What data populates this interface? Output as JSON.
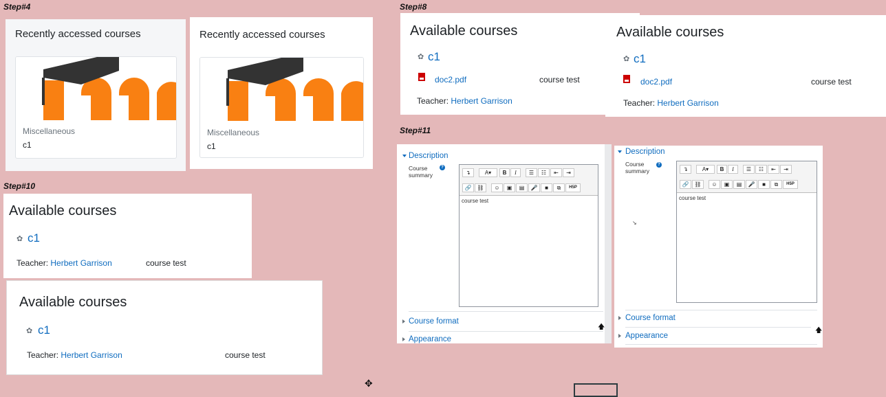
{
  "steps": {
    "step4": "Step#4",
    "step8": "Step#8",
    "step10": "Step#10",
    "step11": "Step#11"
  },
  "recently_accessed": {
    "title": "Recently accessed courses",
    "category": "Miscellaneous",
    "course_name": "c1"
  },
  "available": {
    "title": "Available courses",
    "course_link": "c1",
    "file_name": "doc2.pdf",
    "summary": "course test",
    "teacher_label": "Teacher:",
    "teacher_name": "Herbert Garrison"
  },
  "edit_form": {
    "description_header": "Description",
    "course_summary_label": "Course summary",
    "summary_text": "course test",
    "course_format": "Course format",
    "appearance": "Appearance",
    "toolbar": {
      "undo": "↴",
      "font": "A▾",
      "bold": "B",
      "italic": "I",
      "ul": "☰",
      "ol": "☷",
      "outdent": "⇤",
      "indent": "⇥",
      "link": "🔗",
      "unlink": "⛓",
      "emoji": "☺",
      "image": "▣",
      "media": "▤",
      "record_audio": "🎤",
      "record_video": "■",
      "manage_files": "⧉",
      "h5p": "H5P"
    }
  },
  "colors": {
    "background": "#e4b8b9",
    "link": "#0f6cbf",
    "moodle_orange": "#f98012"
  }
}
